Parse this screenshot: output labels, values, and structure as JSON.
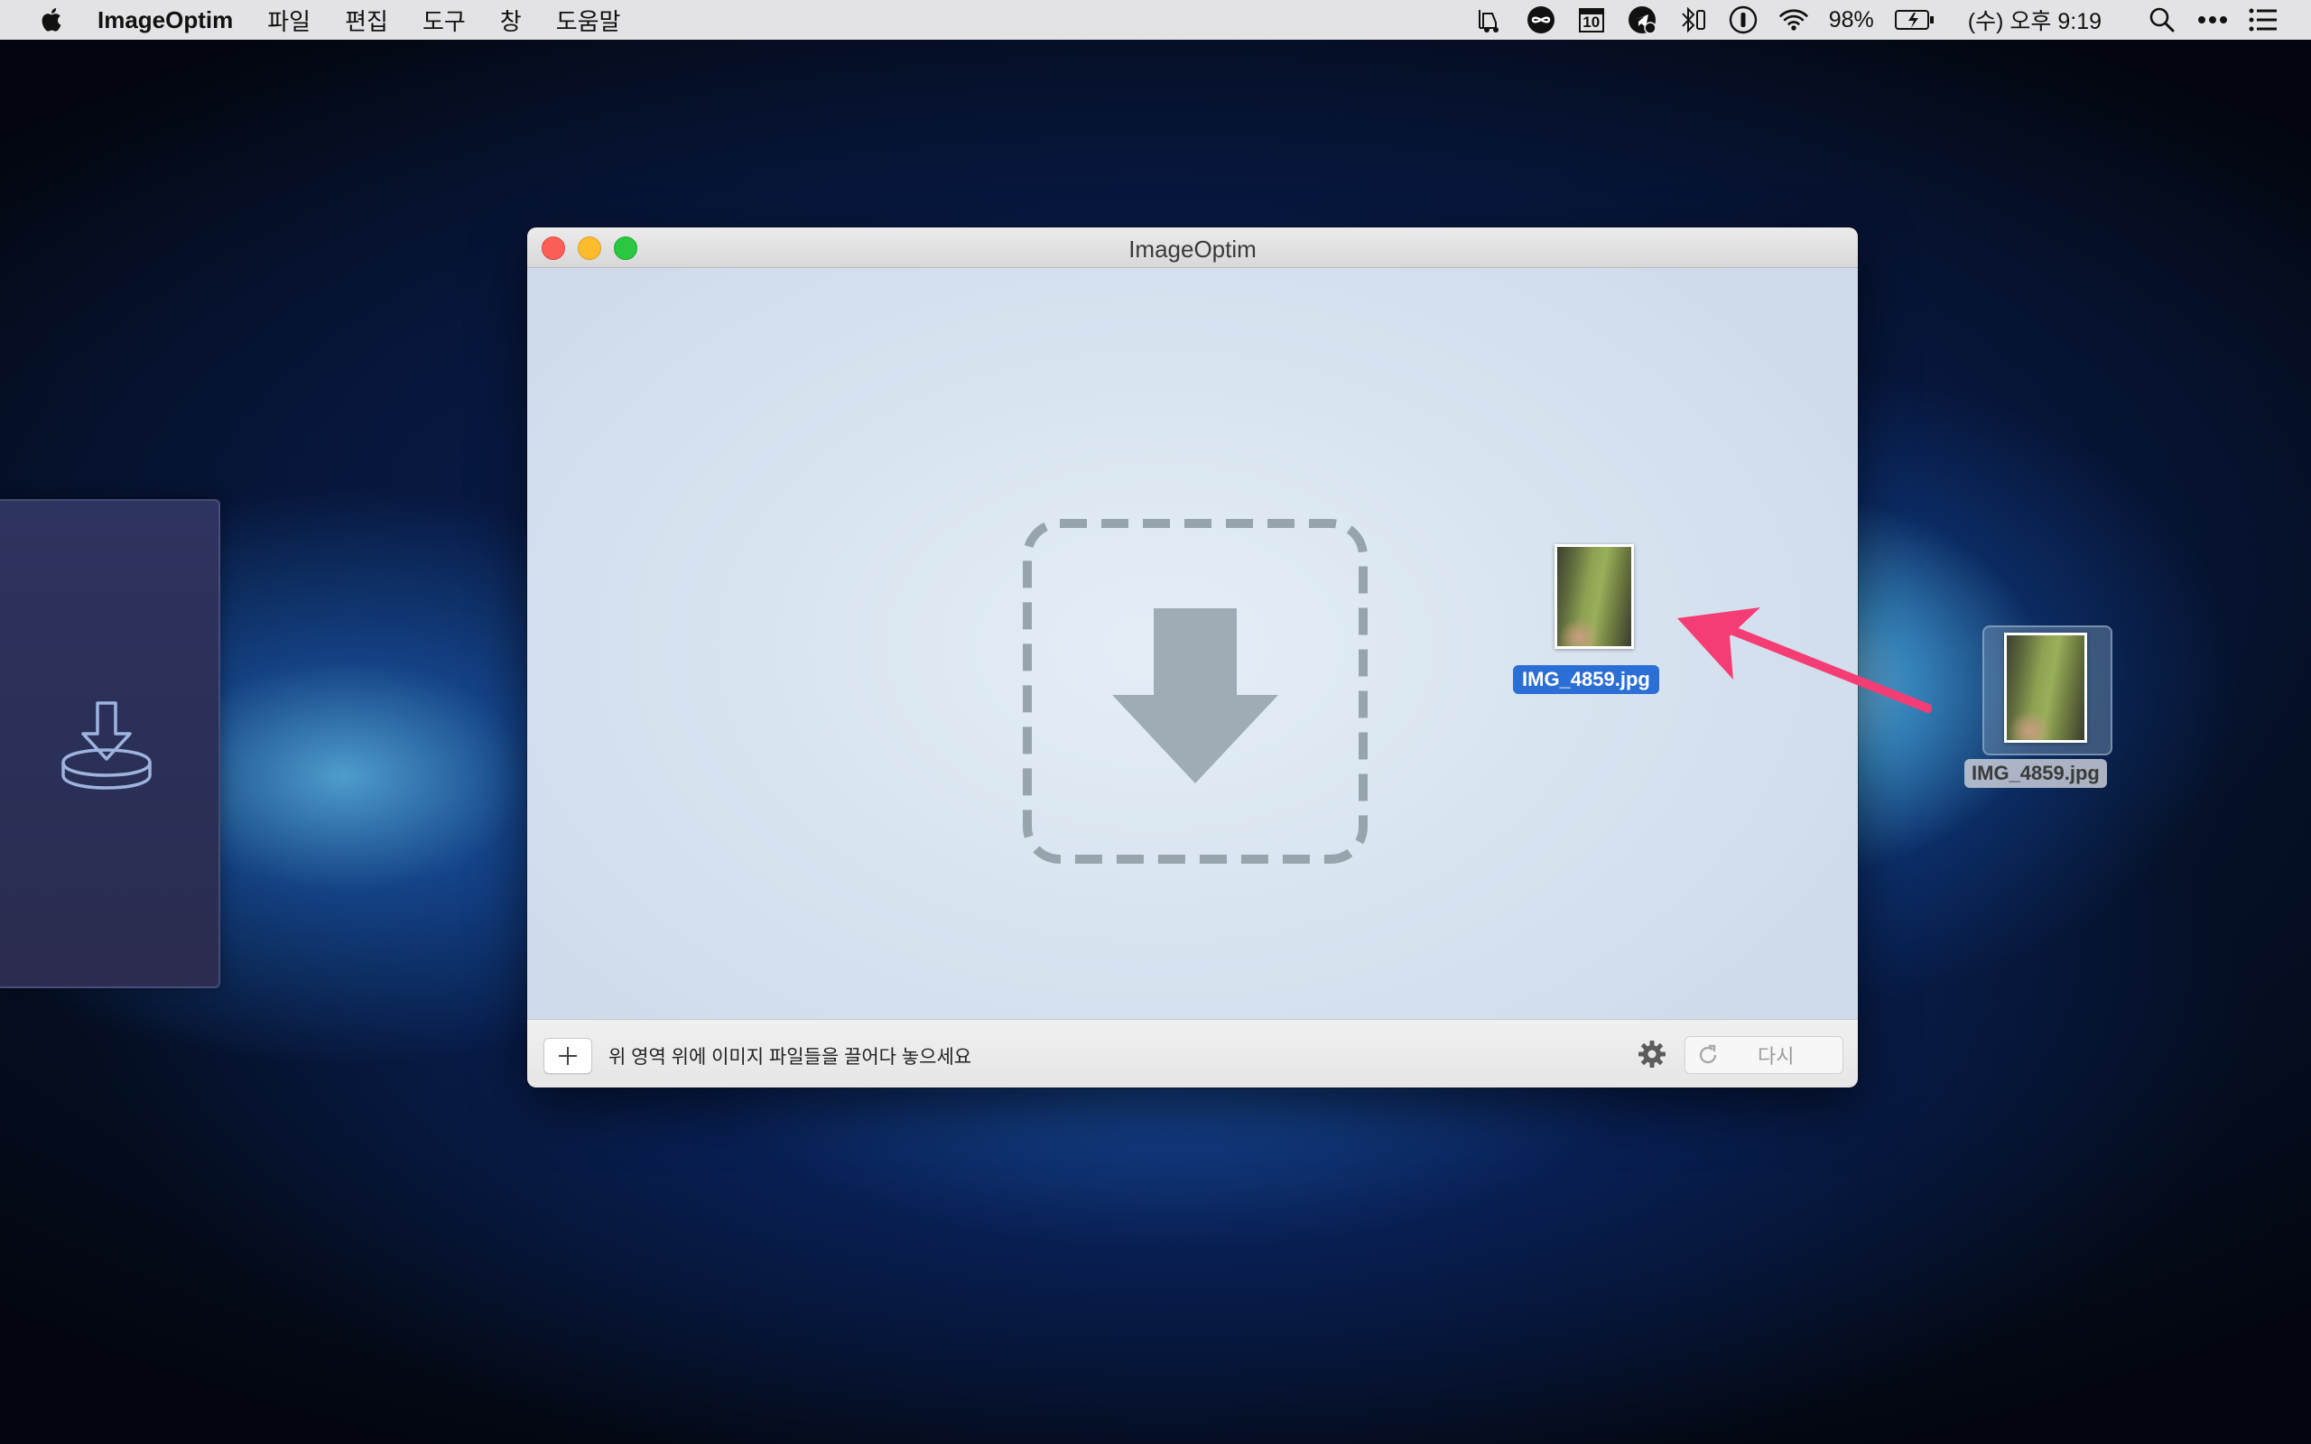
{
  "menubar": {
    "app_name": "ImageOptim",
    "items": [
      "파일",
      "편집",
      "도구",
      "창",
      "도움말"
    ],
    "status": {
      "calendar_day": "10",
      "battery_percent": "98%",
      "clock": "(수) 오후 9:19"
    },
    "icons": [
      "apple-icon",
      "forklift-icon",
      "infinity-icon",
      "calendar-icon",
      "telegram-icon",
      "bluetooth-icon",
      "info-icon",
      "wifi-icon",
      "battery-icon",
      "spotlight-icon",
      "more-icon",
      "notification-center-icon"
    ]
  },
  "window": {
    "title": "ImageOptim",
    "footer": {
      "hint": "위 영역 위에 이미지 파일들을 끌어다 놓으세요",
      "add_icon": "plus-icon",
      "settings_icon": "gear-icon",
      "redo_label": "다시"
    }
  },
  "dragged_file": {
    "name": "IMG_4859.jpg"
  },
  "desktop_file": {
    "name": "IMG_4859.jpg"
  },
  "colors": {
    "selection": "#2b6fd6",
    "arrow": "#f43d74",
    "dropzone": "#98a4ad"
  }
}
